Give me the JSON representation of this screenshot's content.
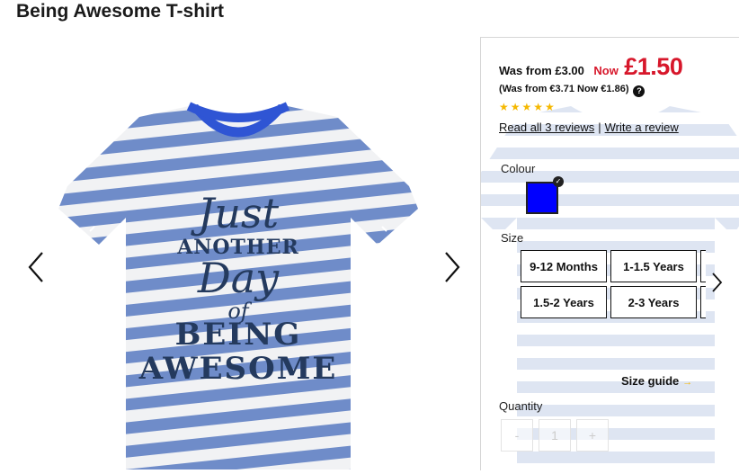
{
  "product": {
    "title": "Being Awesome T-shirt",
    "slogan": {
      "line1": "Just",
      "line2": "ANOTHER",
      "line3": "Day",
      "line4": "of",
      "line5": "BEING",
      "line6": "AWESOME"
    }
  },
  "gallery": {
    "prev_icon": "chevron-left-icon",
    "next_icon": "chevron-right-icon"
  },
  "price": {
    "was_text": "Was from £3.00",
    "now_label": "Now",
    "now_price": "£1.50",
    "euro_text": "(Was from €3.71 Now €1.86)",
    "help_icon": "question-icon",
    "help_glyph": "?"
  },
  "rating": {
    "stars_display": "★★★★★",
    "rating_value": 5,
    "rating_max": 5,
    "read_reviews": "Read all 3 reviews",
    "separator": "|",
    "write_review": "Write a review"
  },
  "colour": {
    "label": "Colour",
    "selected_color": "#0000ff",
    "check_glyph": "✓"
  },
  "size": {
    "label": "Size",
    "options": [
      "9-12 Months",
      "1-1.5 Years",
      "1.5-2 Years",
      "2-3 Years"
    ],
    "next_icon": "chevron-right-icon",
    "guide_label": "Size guide",
    "guide_arrow": "→"
  },
  "quantity": {
    "label": "Quantity",
    "minus": "-",
    "value": "1",
    "plus": "+"
  },
  "colors": {
    "price_red": "#d7172b",
    "star_yellow": "#f5b800",
    "stripe_blue": "#6f8cc9",
    "collar_blue": "#2f55d4"
  }
}
